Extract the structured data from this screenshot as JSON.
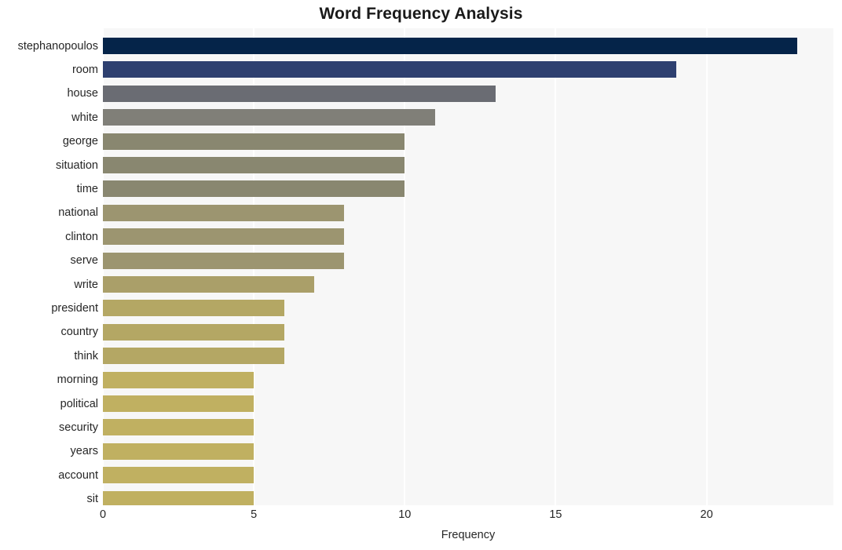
{
  "chart_data": {
    "type": "bar",
    "orientation": "horizontal",
    "title": "Word Frequency Analysis",
    "xlabel": "Frequency",
    "ylabel": "",
    "categories": [
      "stephanopoulos",
      "room",
      "house",
      "white",
      "george",
      "situation",
      "time",
      "national",
      "clinton",
      "serve",
      "write",
      "president",
      "country",
      "think",
      "morning",
      "political",
      "security",
      "years",
      "account",
      "sit"
    ],
    "values": [
      23,
      19,
      13,
      11,
      10,
      10,
      10,
      8,
      8,
      8,
      7,
      6,
      6,
      6,
      5,
      5,
      5,
      5,
      5,
      5
    ],
    "bar_colors": [
      "#052449",
      "#2e4070",
      "#6a6c73",
      "#807f78",
      "#898770",
      "#898770",
      "#898770",
      "#9c9570",
      "#9c9570",
      "#9c9570",
      "#aa9f69",
      "#b4a764",
      "#b4a764",
      "#b4a764",
      "#c0b061",
      "#c0b061",
      "#c0b061",
      "#c0b061",
      "#c0b061",
      "#c0b061"
    ],
    "xticks": [
      0,
      5,
      10,
      15,
      20
    ],
    "xtick_labels": [
      "0",
      "5",
      "10",
      "15",
      "20"
    ],
    "xlim": [
      0,
      24.2
    ],
    "grid": "vertical-white",
    "legend": "none",
    "plot_background": "#f7f7f7",
    "figure_background": "#ffffff",
    "title_color": "#1a1a1a",
    "tick_label_color": "#262626"
  }
}
